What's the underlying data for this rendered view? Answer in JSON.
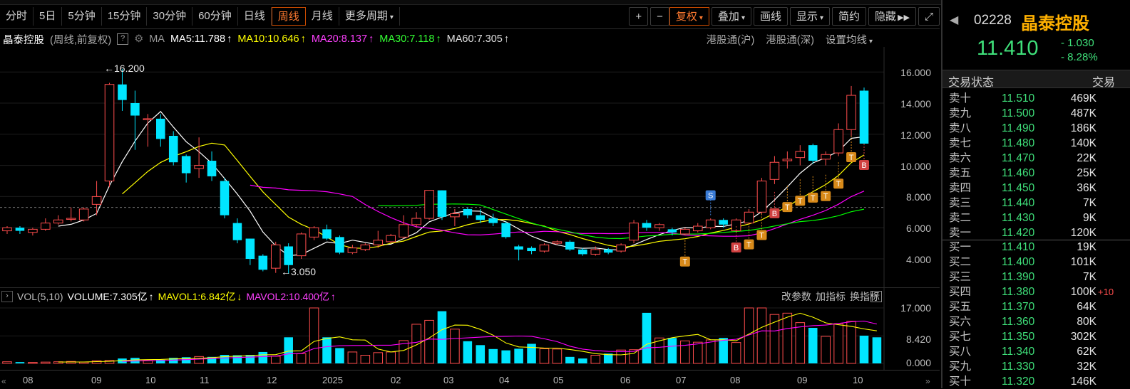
{
  "toolbar": {
    "periods": [
      "分时",
      "5日",
      "5分钟",
      "15分钟",
      "30分钟",
      "60分钟",
      "日线",
      "周线",
      "月线"
    ],
    "more_periods": "更多周期",
    "active_period": "周线",
    "plus_icon": "+",
    "minus_icon": "−",
    "right_buttons": [
      "复权",
      "叠加",
      "画线",
      "显示",
      "简约",
      "隐藏"
    ],
    "expand_icon": "⤢"
  },
  "ma_bar": {
    "stock_name": "晶泰控股",
    "mode": "(周线,前复权)",
    "help": "?",
    "ma_label": "MA",
    "ma5": "MA5:11.788",
    "ma10": "MA10:10.646",
    "ma20": "MA20:8.137",
    "ma30": "MA30:7.118",
    "ma60": "MA60:7.305",
    "up_arrow": "↑",
    "hk_sh": "港股通(沪)",
    "hk_sz": "港股通(深)",
    "set_ma": "设置均线"
  },
  "price_axis": [
    "16.000",
    "14.000",
    "12.000",
    "10.000",
    "8.000",
    "6.000",
    "4.000"
  ],
  "annotations": {
    "high": "16.200",
    "low": "3.050"
  },
  "vol_bar": {
    "label": "VOL(5,10)",
    "volume": "VOLUME:7.305亿",
    "mavol1": "MAVOL1:6.842亿",
    "mavol2": "MAVOL2:10.400亿",
    "up": "↑",
    "down": "↓",
    "change_param": "改参数",
    "add_indicator": "加指标",
    "switch_indicator": "换指标",
    "close": "✕"
  },
  "vol_axis": [
    "17.000",
    "8.420",
    "0.000"
  ],
  "x_axis": [
    "08",
    "09",
    "10",
    "11",
    "12",
    "2025",
    "02",
    "03",
    "04",
    "05",
    "06",
    "07",
    "08",
    "09",
    "10"
  ],
  "quote": {
    "code": "02228",
    "name": "晶泰控股",
    "price": "11.410",
    "change": "- 1.030",
    "change_pct": "- 8.28%",
    "trade_status": "交易状态",
    "trade_col": "交易",
    "sells": [
      {
        "label": "卖十",
        "price": "11.510",
        "vol": "469K"
      },
      {
        "label": "卖九",
        "price": "11.500",
        "vol": "487K"
      },
      {
        "label": "卖八",
        "price": "11.490",
        "vol": "186K"
      },
      {
        "label": "卖七",
        "price": "11.480",
        "vol": "140K"
      },
      {
        "label": "卖六",
        "price": "11.470",
        "vol": "22K"
      },
      {
        "label": "卖五",
        "price": "11.460",
        "vol": "25K"
      },
      {
        "label": "卖四",
        "price": "11.450",
        "vol": "36K"
      },
      {
        "label": "卖三",
        "price": "11.440",
        "vol": "7K"
      },
      {
        "label": "卖二",
        "price": "11.430",
        "vol": "9K"
      },
      {
        "label": "卖一",
        "price": "11.420",
        "vol": "120K"
      }
    ],
    "buys": [
      {
        "label": "买一",
        "price": "11.410",
        "vol": "19K",
        "extra": ""
      },
      {
        "label": "买二",
        "price": "11.400",
        "vol": "101K",
        "extra": ""
      },
      {
        "label": "买三",
        "price": "11.390",
        "vol": "7K",
        "extra": ""
      },
      {
        "label": "买四",
        "price": "11.380",
        "vol": "100K",
        "extra": "+10"
      },
      {
        "label": "买五",
        "price": "11.370",
        "vol": "64K",
        "extra": ""
      },
      {
        "label": "买六",
        "price": "11.360",
        "vol": "80K",
        "extra": ""
      },
      {
        "label": "买七",
        "price": "11.350",
        "vol": "302K",
        "extra": ""
      },
      {
        "label": "买八",
        "price": "11.340",
        "vol": "62K",
        "extra": ""
      },
      {
        "label": "买九",
        "price": "11.330",
        "vol": "32K",
        "extra": ""
      },
      {
        "label": "买十",
        "price": "11.320",
        "vol": "146K",
        "extra": ""
      }
    ]
  },
  "colors": {
    "up": "#ff4d4d",
    "down": "#00e5ff",
    "ma5": "#ffffff",
    "ma10": "#ffff00",
    "ma20": "#ff00ff",
    "ma30": "#00ff00",
    "ma60": "#e0e0e0",
    "accent": "#ff7a30"
  },
  "signals": {
    "t": "T",
    "b": "B",
    "s": "S"
  },
  "chart_data": {
    "type": "candlestick",
    "candles": [
      {
        "o": 5.8,
        "c": 6.0,
        "h": 6.1,
        "l": 5.6
      },
      {
        "o": 6.0,
        "c": 5.8,
        "h": 6.1,
        "l": 5.6
      },
      {
        "o": 5.7,
        "c": 5.9,
        "h": 6.0,
        "l": 5.5
      },
      {
        "o": 5.9,
        "c": 6.3,
        "h": 6.6,
        "l": 5.8
      },
      {
        "o": 6.3,
        "c": 6.5,
        "h": 6.8,
        "l": 6.2
      },
      {
        "o": 6.6,
        "c": 6.6,
        "h": 7.3,
        "l": 6.4
      },
      {
        "o": 6.5,
        "c": 7.2,
        "h": 7.3,
        "l": 6.4
      },
      {
        "o": 7.5,
        "c": 8.0,
        "h": 9.0,
        "l": 6.8
      },
      {
        "o": 9.0,
        "c": 15.2,
        "h": 15.3,
        "l": 8.6
      },
      {
        "o": 15.2,
        "c": 14.2,
        "h": 16.2,
        "l": 13.5
      },
      {
        "o": 14.0,
        "c": 13.2,
        "h": 14.8,
        "l": 11.0
      },
      {
        "o": 13.0,
        "c": 13.0,
        "h": 13.3,
        "l": 11.2
      },
      {
        "o": 13.0,
        "c": 11.7,
        "h": 13.3,
        "l": 11.2
      },
      {
        "o": 11.9,
        "c": 10.2,
        "h": 12.2,
        "l": 10.0
      },
      {
        "o": 10.6,
        "c": 9.5,
        "h": 10.7,
        "l": 8.9
      },
      {
        "o": 9.8,
        "c": 10.0,
        "h": 11.8,
        "l": 9.2
      },
      {
        "o": 10.3,
        "c": 9.3,
        "h": 10.9,
        "l": 9.0
      },
      {
        "o": 9.0,
        "c": 6.8,
        "h": 9.2,
        "l": 6.6
      },
      {
        "o": 6.3,
        "c": 5.2,
        "h": 6.6,
        "l": 5.0
      },
      {
        "o": 5.3,
        "c": 4.0,
        "h": 5.3,
        "l": 3.6
      },
      {
        "o": 4.2,
        "c": 3.3,
        "h": 4.3,
        "l": 3.2
      },
      {
        "o": 3.4,
        "c": 4.9,
        "h": 5.1,
        "l": 3.1
      },
      {
        "o": 4.8,
        "c": 3.6,
        "h": 5.0,
        "l": 3.05
      },
      {
        "o": 4.2,
        "c": 5.6,
        "h": 5.7,
        "l": 4.0
      },
      {
        "o": 5.4,
        "c": 6.0,
        "h": 6.1,
        "l": 5.2
      },
      {
        "o": 5.9,
        "c": 5.3,
        "h": 6.2,
        "l": 5.2
      },
      {
        "o": 5.4,
        "c": 4.4,
        "h": 5.5,
        "l": 4.3
      },
      {
        "o": 4.4,
        "c": 4.7,
        "h": 4.9,
        "l": 4.3
      },
      {
        "o": 4.6,
        "c": 4.9,
        "h": 5.0,
        "l": 4.5
      },
      {
        "o": 4.9,
        "c": 5.2,
        "h": 5.8,
        "l": 4.7
      },
      {
        "o": 5.1,
        "c": 5.5,
        "h": 5.6,
        "l": 5.0
      },
      {
        "o": 5.4,
        "c": 6.2,
        "h": 6.8,
        "l": 5.3
      },
      {
        "o": 6.2,
        "c": 6.6,
        "h": 7.0,
        "l": 6.0
      },
      {
        "o": 6.6,
        "c": 8.4,
        "h": 8.4,
        "l": 6.5
      },
      {
        "o": 8.4,
        "c": 6.7,
        "h": 8.4,
        "l": 6.5
      },
      {
        "o": 6.7,
        "c": 6.9,
        "h": 7.2,
        "l": 6.1
      },
      {
        "o": 7.2,
        "c": 6.8,
        "h": 7.3,
        "l": 6.6
      },
      {
        "o": 6.8,
        "c": 6.5,
        "h": 7.2,
        "l": 6.3
      },
      {
        "o": 6.6,
        "c": 6.3,
        "h": 6.9,
        "l": 6.1
      },
      {
        "o": 6.3,
        "c": 5.4,
        "h": 6.4,
        "l": 5.3
      },
      {
        "o": 4.8,
        "c": 4.6,
        "h": 4.9,
        "l": 3.9
      },
      {
        "o": 4.7,
        "c": 4.5,
        "h": 4.8,
        "l": 4.3
      },
      {
        "o": 4.5,
        "c": 4.9,
        "h": 5.0,
        "l": 4.4
      },
      {
        "o": 5.0,
        "c": 5.1,
        "h": 5.2,
        "l": 4.9
      },
      {
        "o": 5.1,
        "c": 4.6,
        "h": 5.2,
        "l": 4.5
      },
      {
        "o": 4.6,
        "c": 4.3,
        "h": 4.7,
        "l": 4.2
      },
      {
        "o": 4.3,
        "c": 4.6,
        "h": 4.8,
        "l": 4.2
      },
      {
        "o": 4.6,
        "c": 4.4,
        "h": 4.7,
        "l": 4.3
      },
      {
        "o": 4.5,
        "c": 4.9,
        "h": 5.0,
        "l": 4.4
      },
      {
        "o": 5.2,
        "c": 6.3,
        "h": 6.5,
        "l": 5.0
      },
      {
        "o": 6.3,
        "c": 6.0,
        "h": 6.5,
        "l": 5.8
      },
      {
        "o": 6.0,
        "c": 6.2,
        "h": 6.3,
        "l": 5.8
      },
      {
        "o": 5.9,
        "c": 5.7,
        "h": 6.0,
        "l": 5.5
      },
      {
        "o": 5.6,
        "c": 5.9,
        "h": 6.0,
        "l": 5.5
      },
      {
        "o": 5.8,
        "c": 6.1,
        "h": 6.3,
        "l": 5.7
      },
      {
        "o": 6.0,
        "c": 6.5,
        "h": 6.6,
        "l": 5.9
      },
      {
        "o": 6.5,
        "c": 6.2,
        "h": 6.6,
        "l": 6.0
      },
      {
        "o": 5.8,
        "c": 6.5,
        "h": 6.6,
        "l": 5.7
      },
      {
        "o": 6.3,
        "c": 7.0,
        "h": 7.2,
        "l": 6.2
      },
      {
        "o": 7.0,
        "c": 9.0,
        "h": 9.2,
        "l": 6.9
      },
      {
        "o": 9.1,
        "c": 10.2,
        "h": 10.6,
        "l": 8.8
      },
      {
        "o": 10.3,
        "c": 10.4,
        "h": 10.9,
        "l": 9.8
      },
      {
        "o": 10.5,
        "c": 10.9,
        "h": 11.3,
        "l": 10.0
      },
      {
        "o": 11.3,
        "c": 10.3,
        "h": 11.4,
        "l": 10.1
      },
      {
        "o": 10.4,
        "c": 10.7,
        "h": 10.9,
        "l": 10.0
      },
      {
        "o": 10.8,
        "c": 12.3,
        "h": 12.7,
        "l": 10.6
      },
      {
        "o": 12.3,
        "c": 14.5,
        "h": 15.1,
        "l": 11.9
      },
      {
        "o": 14.8,
        "c": 11.4,
        "h": 15.0,
        "l": 11.3
      }
    ],
    "volume": [
      0.5,
      0.4,
      0.3,
      0.4,
      0.5,
      0.6,
      0.4,
      0.8,
      0.9,
      1.5,
      1.7,
      0.9,
      1.1,
      1.7,
      1.9,
      2.1,
      2.0,
      2.6,
      2.5,
      2.6,
      3.5,
      2.2,
      8.0,
      3.0,
      17.0,
      8.0,
      4.7,
      3.5,
      2.5,
      3.3,
      3.5,
      7.0,
      12.0,
      13.2,
      16.0,
      10.5,
      6.8,
      5.6,
      4.4,
      4.0,
      4.5,
      6.0,
      4.5,
      4.4,
      2.0,
      1.5,
      2.5,
      3.0,
      4.1,
      4.2,
      15.5,
      7.8,
      7.8,
      6.9,
      6.5,
      7.2,
      7.8,
      6.4,
      17.0,
      17.0,
      15.0,
      15.4,
      12.5,
      10.9,
      8.3,
      12.2,
      12.9,
      8.5,
      8.0
    ]
  }
}
